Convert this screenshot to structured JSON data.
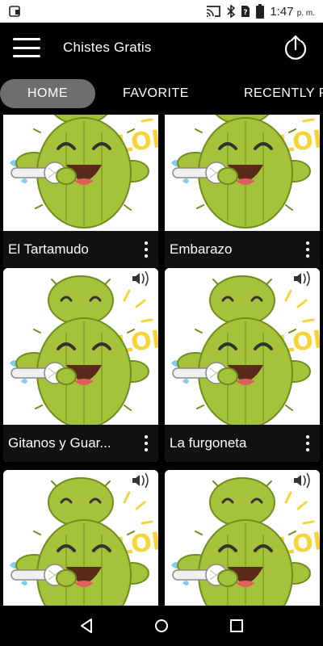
{
  "status_bar": {
    "time": "1:47",
    "ampm": "p. m.",
    "icons": [
      "notification-app-icon",
      "cast-icon",
      "bluetooth-icon",
      "no-sim-icon",
      "battery-icon"
    ]
  },
  "app_bar": {
    "title": "Chistes Gratis",
    "menu_icon": "hamburger-menu-icon",
    "exit_icon": "power-exit-icon"
  },
  "tabs": [
    {
      "label": "HOME",
      "active": true
    },
    {
      "label": "FAVORITE",
      "active": false
    },
    {
      "label": "RECENTLY PL",
      "active": false
    }
  ],
  "jokes": [
    {
      "title": "El Tartamudo",
      "image": "singing-cactus-lol-sticker"
    },
    {
      "title": "Embarazo",
      "image": "singing-cactus-lol-sticker"
    },
    {
      "title": "Gitanos y Guar...",
      "image": "singing-cactus-lol-sticker"
    },
    {
      "title": "La furgoneta",
      "image": "singing-cactus-lol-sticker"
    },
    {
      "title": "",
      "image": "singing-cactus-lol-sticker"
    },
    {
      "title": "",
      "image": "singing-cactus-lol-sticker"
    }
  ],
  "nav_bar": {
    "back_icon": "back-triangle-icon",
    "home_icon": "home-circle-icon",
    "recents_icon": "recents-square-icon"
  },
  "colors": {
    "background": "#000000",
    "active_tab": "#6e6e6e",
    "cactus": "#a4c23a",
    "cactus_dark": "#6f8d1e",
    "lol_yellow": "#f5d43a"
  }
}
